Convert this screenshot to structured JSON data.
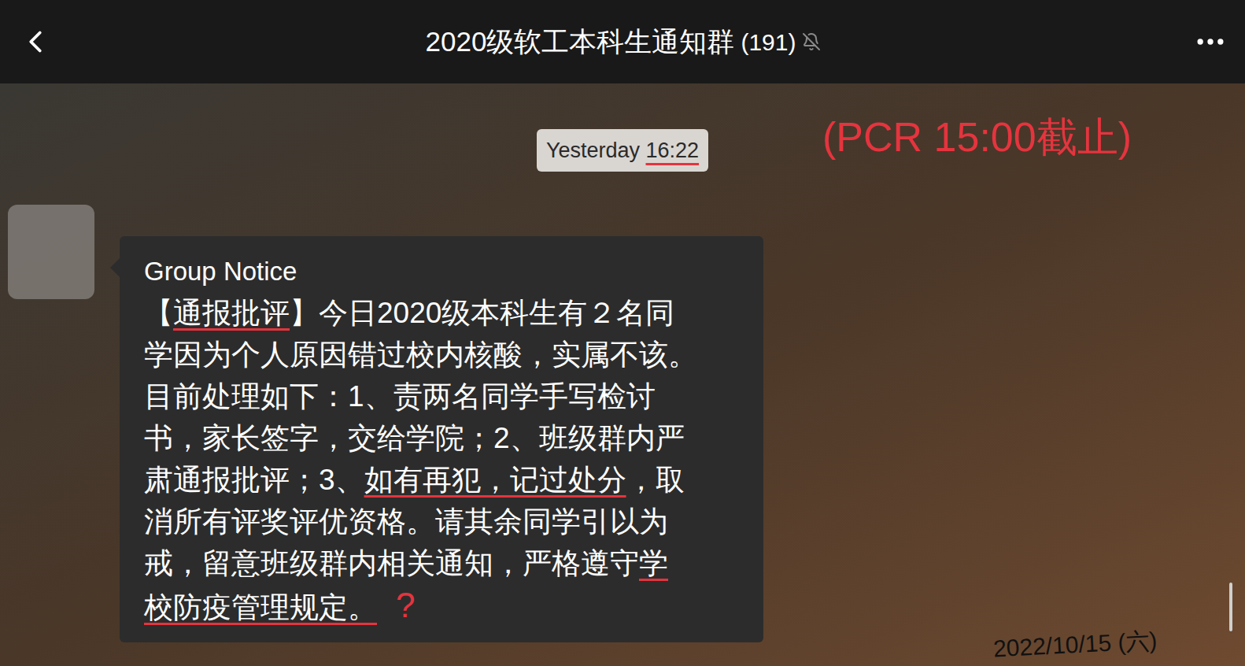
{
  "header": {
    "title": "2020级软工本科生通知群",
    "member_count": "(191)",
    "muted": true
  },
  "timestamp": {
    "segments": [
      {
        "text": "Yesterday ",
        "underlined": false
      },
      {
        "text": "16:22",
        "underlined": true
      }
    ]
  },
  "notice": {
    "title": "Group Notice",
    "lines": [
      [
        {
          "text": "【",
          "underlined": false
        },
        {
          "text": "通报批评",
          "underlined": true
        },
        {
          "text": "】今日2020级本科生有２名同",
          "underlined": false
        }
      ],
      [
        {
          "text": "学因为个人原因错过校内核酸，实属不该。",
          "underlined": false
        }
      ],
      [
        {
          "text": "目前处理如下：1、责两名同学手写检讨",
          "underlined": false
        }
      ],
      [
        {
          "text": "书，家长签字，交给学院；2、班级群内严",
          "underlined": false
        }
      ],
      [
        {
          "text": "肃通报批评；3、",
          "underlined": false
        },
        {
          "text": "如有再犯，记过处分",
          "underlined": true
        },
        {
          "text": "，取",
          "underlined": false
        }
      ],
      [
        {
          "text": "消所有评奖评优资格。请其余同学引以为",
          "underlined": false
        }
      ],
      [
        {
          "text": "戒，留意班级群内相关通知，严格遵守",
          "underlined": false
        },
        {
          "text": "学",
          "underlined": true
        }
      ],
      [
        {
          "text": "校防疫管理规定。",
          "underlined": true
        }
      ]
    ]
  },
  "annotations": {
    "deadline": "(PCR 15:00截止)",
    "question_mark": "?",
    "date": "2022/10/15 (六)"
  }
}
